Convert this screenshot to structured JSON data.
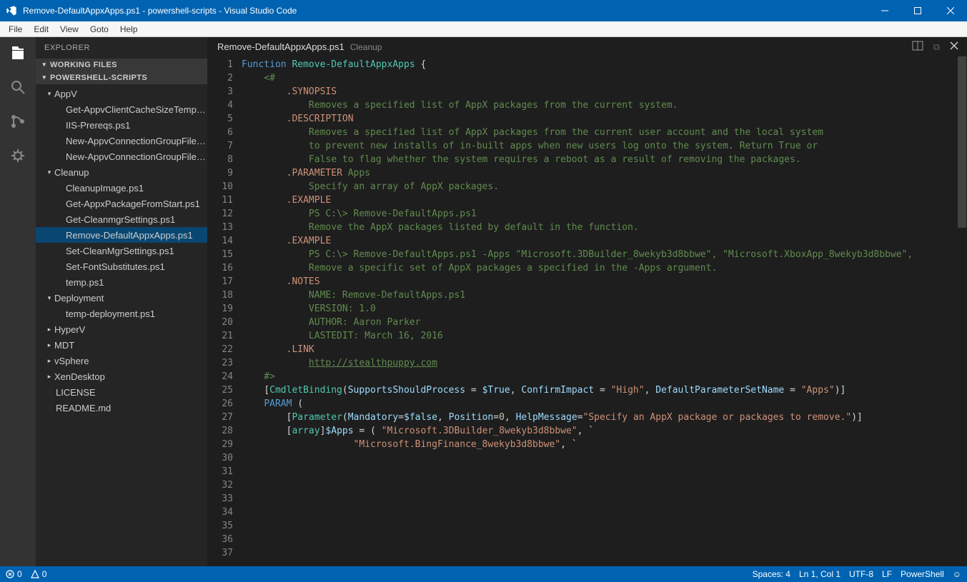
{
  "window": {
    "title": "Remove-DefaultAppxApps.ps1 - powershell-scripts - Visual Studio Code"
  },
  "menu": [
    "File",
    "Edit",
    "View",
    "Goto",
    "Help"
  ],
  "sidebar": {
    "title": "EXPLORER",
    "sections": [
      {
        "label": "WORKING FILES",
        "expanded": true,
        "items": []
      },
      {
        "label": "POWERSHELL-SCRIPTS",
        "expanded": true
      }
    ],
    "tree": [
      {
        "label": "AppV",
        "type": "folder",
        "expanded": true,
        "depth": 0
      },
      {
        "label": "Get-AppvClientCacheSizeTemp…",
        "type": "file",
        "depth": 1
      },
      {
        "label": "IIS-Prereqs.ps1",
        "type": "file",
        "depth": 1
      },
      {
        "label": "New-AppvConnectionGroupFile…",
        "type": "file",
        "depth": 1
      },
      {
        "label": "New-AppvConnectionGroupFile…",
        "type": "file",
        "depth": 1
      },
      {
        "label": "Cleanup",
        "type": "folder",
        "expanded": true,
        "depth": 0
      },
      {
        "label": "CleanupImage.ps1",
        "type": "file",
        "depth": 1
      },
      {
        "label": "Get-AppxPackageFromStart.ps1",
        "type": "file",
        "depth": 1
      },
      {
        "label": "Get-CleanmgrSettings.ps1",
        "type": "file",
        "depth": 1
      },
      {
        "label": "Remove-DefaultAppxApps.ps1",
        "type": "file",
        "depth": 1,
        "selected": true
      },
      {
        "label": "Set-CleanMgrSettings.ps1",
        "type": "file",
        "depth": 1
      },
      {
        "label": "Set-FontSubstitutes.ps1",
        "type": "file",
        "depth": 1
      },
      {
        "label": "temp.ps1",
        "type": "file",
        "depth": 1
      },
      {
        "label": "Deployment",
        "type": "folder",
        "expanded": true,
        "depth": 0
      },
      {
        "label": "temp-deployment.ps1",
        "type": "file",
        "depth": 1
      },
      {
        "label": "HyperV",
        "type": "folder",
        "expanded": false,
        "depth": 0
      },
      {
        "label": "MDT",
        "type": "folder",
        "expanded": false,
        "depth": 0
      },
      {
        "label": "vSphere",
        "type": "folder",
        "expanded": false,
        "depth": 0
      },
      {
        "label": "XenDesktop",
        "type": "folder",
        "expanded": false,
        "depth": 0
      },
      {
        "label": "LICENSE",
        "type": "file",
        "depth": 0
      },
      {
        "label": "README.md",
        "type": "file",
        "depth": 0
      }
    ]
  },
  "editor": {
    "filename": "Remove-DefaultAppxApps.ps1",
    "group": "Cleanup",
    "total_lines": 37,
    "code_lines": [
      {
        "tokens": [
          [
            "kw",
            "Function"
          ],
          [
            "",
            ""
          ],
          [
            "fn",
            "Remove-DefaultAppxApps"
          ],
          [
            "",
            ""
          ],
          [
            "br",
            "{"
          ]
        ]
      },
      {
        "tokens": [
          [
            "cm",
            "    <#"
          ]
        ]
      },
      {
        "tokens": [
          [
            "",
            "        "
          ],
          [
            "dot",
            ".SYNOPSIS"
          ]
        ]
      },
      {
        "tokens": [
          [
            "cm",
            "            Removes a specified list of AppX packages from the current system."
          ]
        ]
      },
      {
        "tokens": [
          [
            "",
            ""
          ]
        ]
      },
      {
        "tokens": [
          [
            "",
            "        "
          ],
          [
            "dot",
            ".DESCRIPTION"
          ]
        ]
      },
      {
        "tokens": [
          [
            "cm",
            "            Removes a specified list of AppX packages from the current user account and the local system"
          ]
        ]
      },
      {
        "tokens": [
          [
            "cm",
            "            to prevent new installs of in-built apps when new users log onto the system. Return True or"
          ]
        ]
      },
      {
        "tokens": [
          [
            "cm",
            "            False to flag whether the system requires a reboot as a result of removing the packages."
          ]
        ]
      },
      {
        "tokens": [
          [
            "",
            ""
          ]
        ]
      },
      {
        "tokens": [
          [
            "",
            "        "
          ],
          [
            "dot",
            ".PARAMETER"
          ],
          [
            "cm",
            " Apps"
          ]
        ]
      },
      {
        "tokens": [
          [
            "cm",
            "            Specify an array of AppX packages."
          ]
        ]
      },
      {
        "tokens": [
          [
            "",
            ""
          ]
        ]
      },
      {
        "tokens": [
          [
            "",
            "        "
          ],
          [
            "dot",
            ".EXAMPLE"
          ]
        ]
      },
      {
        "tokens": [
          [
            "cm",
            "            PS C:\\> Remove-DefaultApps.ps1"
          ]
        ]
      },
      {
        "tokens": [
          [
            "",
            ""
          ]
        ]
      },
      {
        "tokens": [
          [
            "cm",
            "            Remove the AppX packages listed by default in the function."
          ]
        ]
      },
      {
        "tokens": [
          [
            "",
            ""
          ]
        ]
      },
      {
        "tokens": [
          [
            "",
            "        "
          ],
          [
            "dot",
            ".EXAMPLE"
          ]
        ]
      },
      {
        "tokens": [
          [
            "cm",
            "            PS C:\\> Remove-DefaultApps.ps1 -Apps \"Microsoft.3DBuilder_8wekyb3d8bbwe\", \"Microsoft.XboxApp_8wekyb3d8bbwe\","
          ]
        ]
      },
      {
        "tokens": [
          [
            "",
            ""
          ]
        ]
      },
      {
        "tokens": [
          [
            "cm",
            "            Remove a specific set of AppX packages a specified in the -Apps argument."
          ]
        ]
      },
      {
        "tokens": [
          [
            "",
            ""
          ]
        ]
      },
      {
        "tokens": [
          [
            "",
            "        "
          ],
          [
            "dot",
            ".NOTES"
          ]
        ]
      },
      {
        "tokens": [
          [
            "cm",
            "            NAME: Remove-DefaultApps.ps1"
          ]
        ]
      },
      {
        "tokens": [
          [
            "cm",
            "            VERSION: 1.0"
          ]
        ]
      },
      {
        "tokens": [
          [
            "cm",
            "            AUTHOR: Aaron Parker"
          ]
        ]
      },
      {
        "tokens": [
          [
            "cm",
            "            LASTEDIT: March 16, 2016"
          ]
        ]
      },
      {
        "tokens": [
          [
            "",
            ""
          ]
        ]
      },
      {
        "tokens": [
          [
            "",
            "        "
          ],
          [
            "dot",
            ".LINK"
          ]
        ]
      },
      {
        "tokens": [
          [
            "",
            "            "
          ],
          [
            "link",
            "http://stealthpuppy.com"
          ]
        ]
      },
      {
        "tokens": [
          [
            "cm",
            "    #>"
          ]
        ]
      },
      {
        "tokens": [
          [
            "",
            "    "
          ],
          [
            "punc",
            "["
          ],
          [
            "attr",
            "CmdletBinding"
          ],
          [
            "punc",
            "("
          ],
          [
            "ps",
            "SupportsShouldProcess"
          ],
          [
            "punc",
            " = "
          ],
          [
            "var",
            "$True"
          ],
          [
            "punc",
            ", "
          ],
          [
            "ps",
            "ConfirmImpact"
          ],
          [
            "punc",
            " = "
          ],
          [
            "str",
            "\"High\""
          ],
          [
            "punc",
            ", "
          ],
          [
            "ps",
            "DefaultParameterSetName"
          ],
          [
            "punc",
            " = "
          ],
          [
            "str",
            "\"Apps\""
          ],
          [
            "punc",
            ")"
          ],
          [
            "punc",
            "]"
          ]
        ]
      },
      {
        "tokens": [
          [
            "",
            "    "
          ],
          [
            "kw",
            "PARAM"
          ],
          [
            "punc",
            " ("
          ]
        ]
      },
      {
        "tokens": [
          [
            "",
            "        "
          ],
          [
            "punc",
            "["
          ],
          [
            "attr",
            "Parameter"
          ],
          [
            "punc",
            "("
          ],
          [
            "ps",
            "Mandatory"
          ],
          [
            "punc",
            "="
          ],
          [
            "var",
            "$false"
          ],
          [
            "punc",
            ", "
          ],
          [
            "ps",
            "Position"
          ],
          [
            "punc",
            "="
          ],
          [
            "num",
            "0"
          ],
          [
            "punc",
            ", "
          ],
          [
            "ps",
            "HelpMessage"
          ],
          [
            "punc",
            "="
          ],
          [
            "str",
            "\"Specify an AppX package or packages to remove.\""
          ],
          [
            "punc",
            ")"
          ],
          [
            "punc",
            "]"
          ]
        ]
      },
      {
        "tokens": [
          [
            "",
            "        "
          ],
          [
            "punc",
            "["
          ],
          [
            "type",
            "array"
          ],
          [
            "punc",
            "]"
          ],
          [
            "var",
            "$Apps"
          ],
          [
            "punc",
            " = ( "
          ],
          [
            "str",
            "\"Microsoft.3DBuilder_8wekyb3d8bbwe\""
          ],
          [
            "punc",
            ", `"
          ]
        ]
      },
      {
        "tokens": [
          [
            "",
            "                    "
          ],
          [
            "str",
            "\"Microsoft.BingFinance_8wekyb3d8bbwe\""
          ],
          [
            "punc",
            ", `"
          ]
        ]
      }
    ]
  },
  "statusbar": {
    "errors": "0",
    "warnings": "0",
    "spaces": "Spaces: 4",
    "cursor": "Ln 1, Col 1",
    "encoding": "UTF-8",
    "eol": "LF",
    "lang": "PowerShell"
  }
}
